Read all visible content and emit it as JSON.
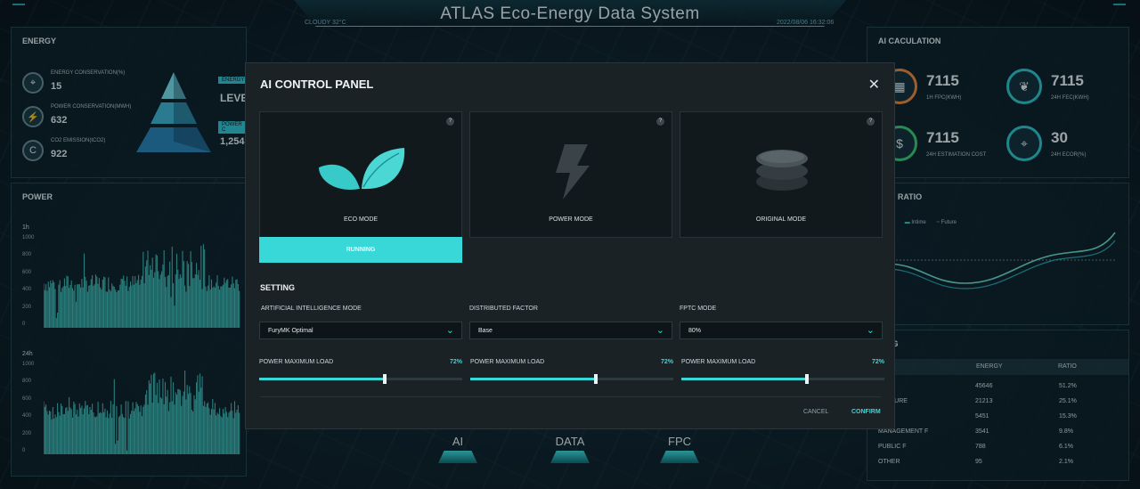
{
  "header": {
    "title": "ATLAS Eco-Energy Data System",
    "weather": "CLOUDY  32°C",
    "datetime": "2022/08/06  16:32:06"
  },
  "energy_panel": {
    "title": "ENERGY",
    "items": [
      {
        "label": "ENERGY CONSERVATION(%)",
        "value": "15",
        "icon": "target-icon"
      },
      {
        "label": "POWER CONSERVATION(MWH)",
        "value": "632",
        "icon": "bolt-icon"
      },
      {
        "label": "CO2 EMISSION(tCO2)",
        "value": "922",
        "icon": "co2-icon"
      }
    ],
    "tag1": "ENERGY",
    "level": "LEVE",
    "tag2": "POWER C",
    "power_value": "1,254"
  },
  "power_panel": {
    "title": "POWER",
    "chart1_label": "1h",
    "chart2_label": "24h",
    "yticks": [
      "1000",
      "800",
      "600",
      "400",
      "200",
      "0"
    ]
  },
  "ai_calc_panel": {
    "title": "AI CACULATION",
    "items": [
      {
        "value": "7115",
        "label": "1H FPC(KWH)",
        "icon": "building-icon"
      },
      {
        "value": "7115",
        "label": "24H FEC(KWH)",
        "icon": "leaf-icon"
      },
      {
        "value": "7115",
        "label": "24H ESTIMATION COST",
        "icon": "dollar-icon"
      },
      {
        "value": "30",
        "label": "24H ECOR(%)",
        "icon": "target-icon"
      }
    ]
  },
  "ratio_panel": {
    "title": "RGY RATIO",
    "legend": [
      "riginal",
      "Intime",
      "Future"
    ]
  },
  "ranking_panel": {
    "title": "KING",
    "columns": [
      "ENERGY",
      "RATIO"
    ],
    "rows": [
      {
        "name": "NESS",
        "energy": "45646",
        "ratio": "51.2%"
      },
      {
        "name": "ERATURE",
        "energy": "21213",
        "ratio": "25.1%"
      },
      {
        "name": "TING",
        "energy": "5451",
        "ratio": "15.3%"
      },
      {
        "name": "MANAGEMENT F",
        "energy": "3541",
        "ratio": "9.8%"
      },
      {
        "name": "PUBLIC F",
        "energy": "788",
        "ratio": "6.1%"
      },
      {
        "name": "OTHER",
        "energy": "95",
        "ratio": "2.1%"
      }
    ]
  },
  "bottom_nav": {
    "ai": "AI",
    "data": "DATA",
    "fpc": "FPC"
  },
  "modal": {
    "title": "AI CONTROL PANEL",
    "close": "✕",
    "modes": [
      {
        "label": "ECO MODE"
      },
      {
        "label": "POWER MODE"
      },
      {
        "label": "ORIGINAL MODE"
      }
    ],
    "running": "RUNNING",
    "setting_title": "SETTING",
    "fields": [
      {
        "label": "ARTIFICIAL INTELLIGENCE MODE",
        "value": "FuryMK Optimal"
      },
      {
        "label": "DISTRIBUTED FACTOR",
        "value": "Base"
      },
      {
        "label": "FPTC MODE",
        "value": "80%"
      }
    ],
    "sliders": [
      {
        "label": "POWER MAXIMUM LOAD",
        "pct": "72%",
        "value": 0.62
      },
      {
        "label": "POWER MAXIMUM LOAD",
        "pct": "72%",
        "value": 0.62
      },
      {
        "label": "POWER MAXIMUM LOAD",
        "pct": "72%",
        "value": 0.62
      }
    ],
    "cancel": "CANCEL",
    "confirm": "CONFIRM"
  },
  "colors": {
    "accent": "#38d8d8",
    "panel": "#1a2226",
    "bg": "#0b1a22"
  }
}
